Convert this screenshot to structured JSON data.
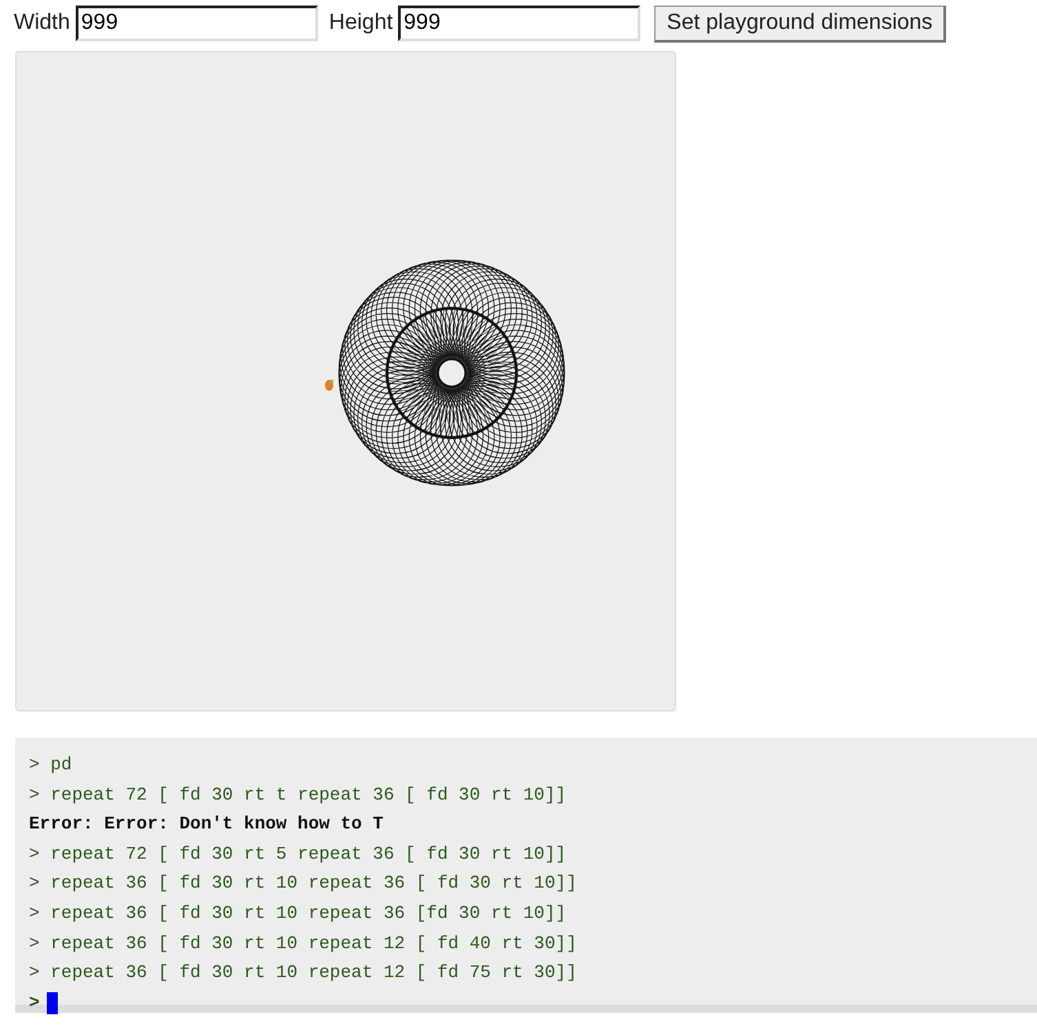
{
  "toolbar": {
    "width_label": "Width",
    "width_value": "999",
    "height_label": "Height",
    "height_value": "999",
    "button": "Set playground dimensions"
  },
  "console": {
    "lines": [
      {
        "kind": "input",
        "text": "> pd"
      },
      {
        "kind": "input",
        "text": "> repeat 72 [ fd 30 rt t repeat 36 [ fd 30 rt 10]]"
      },
      {
        "kind": "error",
        "text": "Error: Error: Don't know how to T"
      },
      {
        "kind": "input",
        "text": "> repeat 72 [ fd 30 rt 5 repeat 36 [ fd 30 rt 10]]"
      },
      {
        "kind": "input",
        "text": "> repeat 36 [ fd 30 rt 10 repeat 36 [ fd 30 rt 10]]"
      },
      {
        "kind": "input",
        "text": "> repeat 36 [ fd 30 rt 10 repeat 36 [fd 30 rt 10]]"
      },
      {
        "kind": "input",
        "text": "> repeat 36 [ fd 30 rt 10 repeat 12 [ fd 40 rt 30]]"
      },
      {
        "kind": "input",
        "text": "> repeat 36 [ fd 30 rt 10 repeat 12 [ fd 75 rt 30]]"
      }
    ],
    "prompt": ">"
  }
}
